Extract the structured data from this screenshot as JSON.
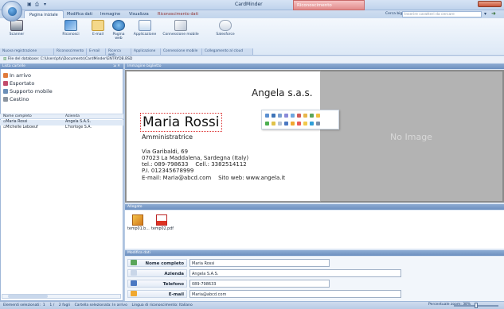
{
  "window": {
    "app_title": "CardMinder",
    "context_tab": "Riconoscimento",
    "context_subtab": "Riconoscimento dati"
  },
  "tabs": [
    "Pagina iniziale",
    "Modifica dati",
    "Immagine",
    "Visualizza"
  ],
  "search": {
    "label": "Cerca biglietto",
    "placeholder": "Inserire caratteri da cercare"
  },
  "ribbon": {
    "buttons": [
      {
        "label": "Scanner"
      },
      {
        "label": "Riconosci"
      },
      {
        "label": "E-mail"
      },
      {
        "label": "Pagina web"
      },
      {
        "label": "Applicazione"
      },
      {
        "label": "Connessione mobile"
      },
      {
        "label": "Salesforce"
      }
    ],
    "groups": [
      "Nuova registrazione",
      "Riconoscimento",
      "E-mail",
      "Ricerca web",
      "Applicazione",
      "Connessione mobile",
      "Collegamento al cloud"
    ]
  },
  "db_path": "File del database: C:\\Users\\pfu\\Documents\\CardMinder\\ENTRYDB.BSD",
  "left_panel": {
    "title": "Lista cartelle",
    "folders": [
      "In arrivo",
      "Esportato",
      "Supporto mobile",
      "Cestino"
    ],
    "table": {
      "headers": [
        "Nome completo",
        "Azienda"
      ],
      "rows": [
        {
          "name": "Maria Rossi",
          "company": "Angela S.A.S."
        },
        {
          "name": "Michelle Leboeuf",
          "company": "L'horloge S.A."
        }
      ]
    }
  },
  "image_panel": {
    "title": "Immagine biglietto",
    "no_image": "No Image",
    "card": {
      "company": "Angela s.a.s.",
      "name": "Maria Rossi",
      "role": "Amministratrice",
      "lines": [
        "Via Garibaldi, 69",
        "07023 La Maddalena, Sardegna (Italy)",
        "tel.: 089-798633    Cell.: 3382514112",
        "P.I. 012345678999",
        "E-mail: Maria@abcd.com    Sito web: www.angela.it"
      ]
    }
  },
  "attachments": {
    "title": "Allegato",
    "files": [
      "temp01.b...",
      "temp02.pdf"
    ]
  },
  "edit_data": {
    "title": "Modifica dati",
    "fields": [
      {
        "label": "Nome completo",
        "value": "Maria Rossi"
      },
      {
        "label": "Azienda",
        "value": "Angela S.A.S."
      },
      {
        "label": "Telefono",
        "value": "089-798633"
      },
      {
        "label": "E-mail",
        "value": "Maria@abcd.com"
      }
    ]
  },
  "status": {
    "text": "Elementi selezionati:  1    1 /    2 fogli    Cartella selezionata: In arrivo    Lingua di riconoscimento: Italiano",
    "zoom_label": "Percentuale zoom: 38%"
  },
  "colors": {
    "ribbon_accent": "#1e3d66",
    "context_tab": "#e18c8c",
    "no_image_bg": "#b3b3b3"
  }
}
